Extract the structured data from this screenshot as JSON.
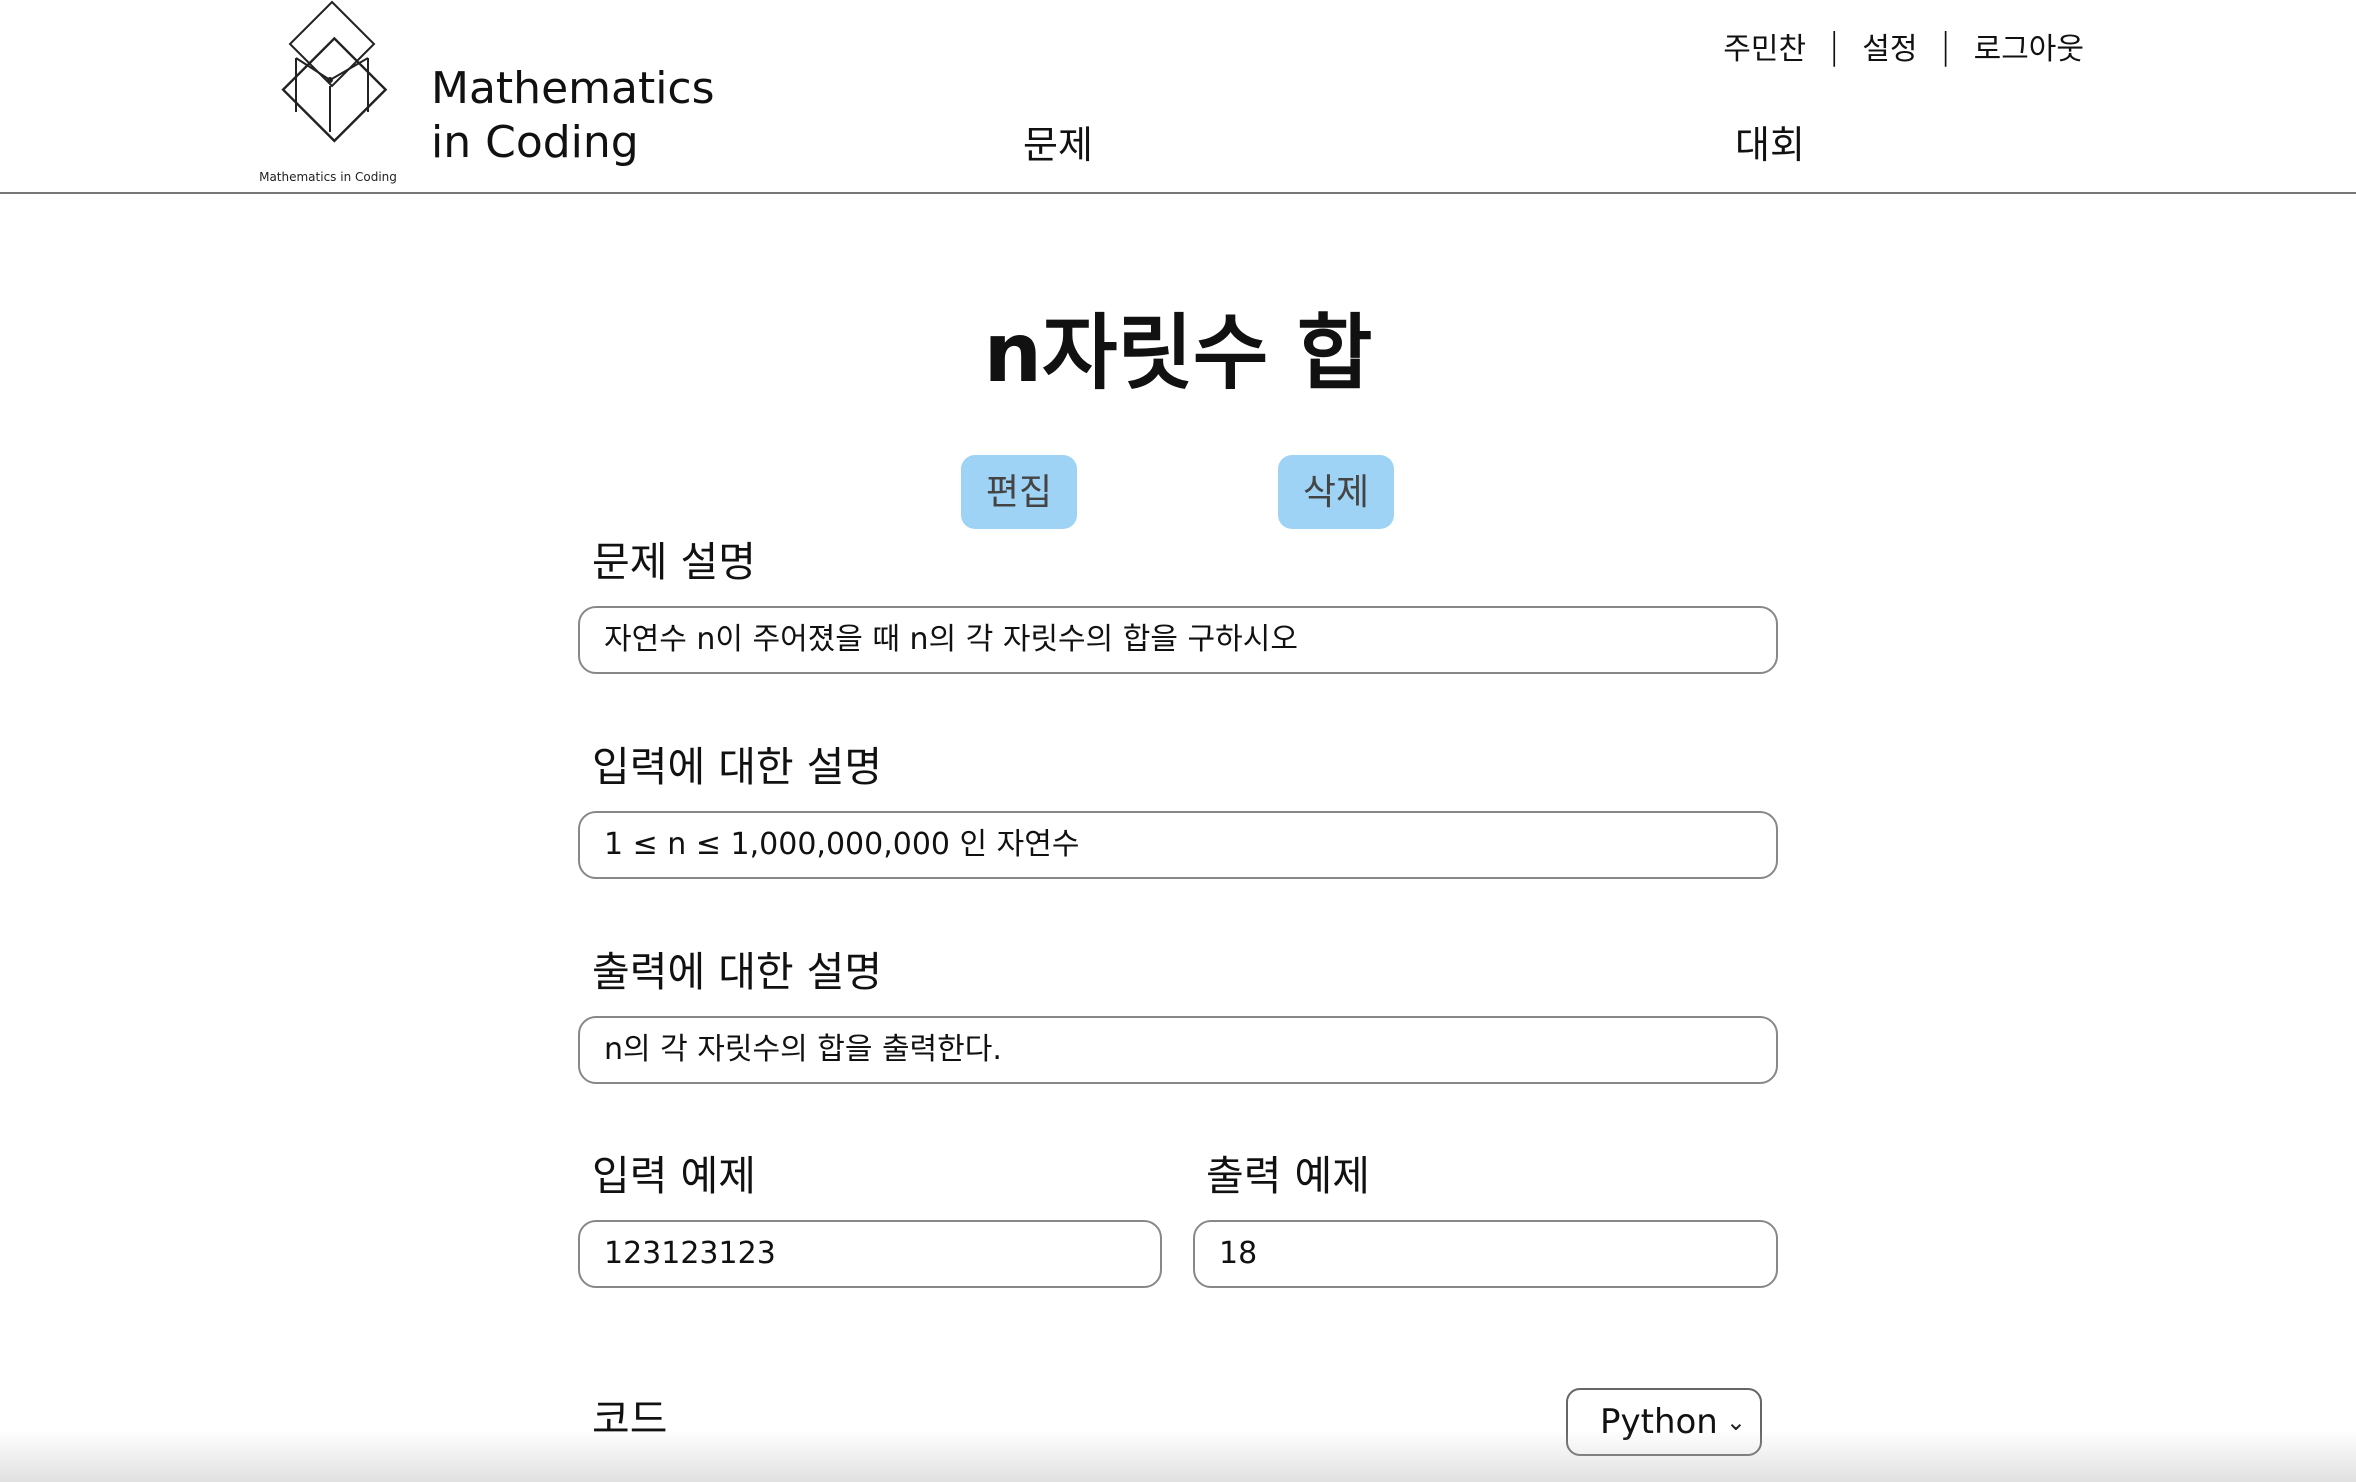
{
  "header": {
    "logo_caption": "Mathematics in Coding",
    "brand_line1": "Mathematics",
    "brand_line2": "in Coding",
    "nav": {
      "problems": "문제",
      "contest": "대회"
    },
    "user": {
      "name": "주민찬",
      "separator": "|",
      "settings": "설정",
      "logout": "로그아웃"
    }
  },
  "problem": {
    "title": "n자릿수 합",
    "edit_label": "편집",
    "delete_label": "삭제",
    "description_label": "문제 설명",
    "description_value": "자연수 n이 주어졌을 때 n의 각 자릿수의 합을 구하시오",
    "input_desc_label": "입력에 대한 설명",
    "input_desc_value": "1 ≤ n ≤ 1,000,000,000 인 자연수",
    "output_desc_label": "출력에 대한 설명",
    "output_desc_value": "n의 각 자릿수의 합을 출력한다.",
    "input_example_label": "입력 예제",
    "input_example_value": "123123123",
    "output_example_label": "출력 예제",
    "output_example_value": "18",
    "code_label": "코드",
    "language_selected": "Python"
  },
  "colors": {
    "button_bg": "#9ed3f6",
    "border": "#888888"
  }
}
